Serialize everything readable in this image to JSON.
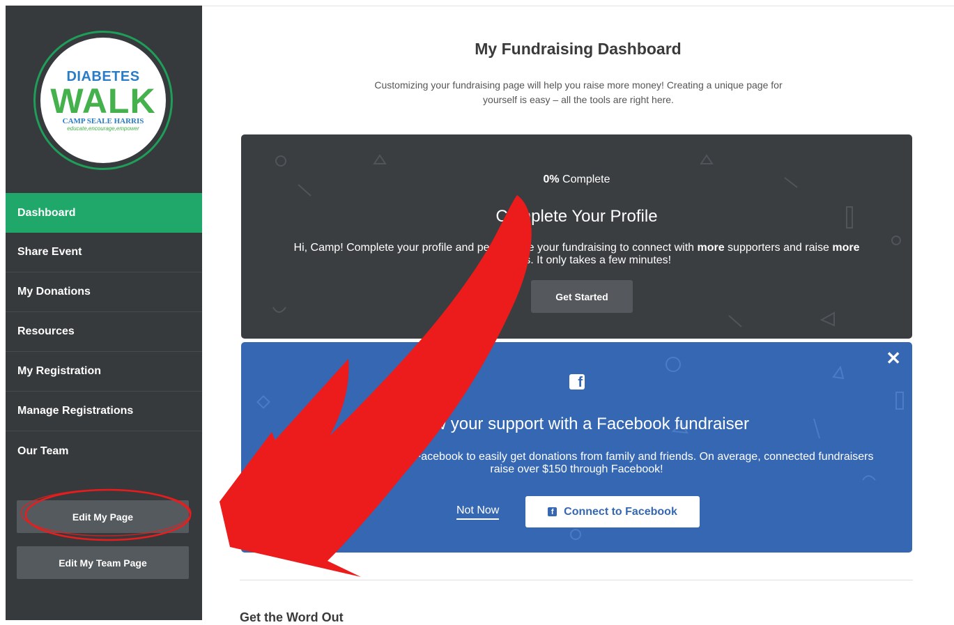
{
  "logo": {
    "top": "DIABETES",
    "walk": "WALK",
    "camp": "CAMP SEALE HARRIS",
    "tagline": "educate,encourage,empower"
  },
  "sidebar": {
    "items": [
      {
        "label": "Dashboard",
        "active": true
      },
      {
        "label": "Share Event"
      },
      {
        "label": "My Donations"
      },
      {
        "label": "Resources"
      },
      {
        "label": "My Registration"
      },
      {
        "label": "Manage Registrations"
      },
      {
        "label": "Our Team"
      }
    ],
    "buttons": {
      "edit_page": "Edit My Page",
      "edit_team_page": "Edit My Team Page"
    }
  },
  "main": {
    "title": "My Fundraising Dashboard",
    "subtitle": "Customizing your fundraising page will help you raise more money! Creating a unique page for yourself is easy – all the tools are right here.",
    "profile_card": {
      "progress_value": "0%",
      "progress_label": "Complete",
      "heading": "Complete Your Profile",
      "text_part1": "Hi, Camp! Complete your profile and personalize your fundraising to connect with ",
      "text_bold1": "more",
      "text_part2": " supporters and raise ",
      "text_bold2": "more",
      "text_part3": " donations. It only takes a few minutes!",
      "button": "Get Started"
    },
    "facebook_card": {
      "close": "✕",
      "heading": "Show your support with a Facebook fundraiser",
      "text": "Connect your fundraiser to Facebook to easily get donations from family and friends. On average, connected fundraisers raise over $150 through Facebook!",
      "not_now": "Not Now",
      "connect": "Connect to Facebook"
    },
    "section_title": "Get the Word Out"
  },
  "colors": {
    "sidebar": "#363a3d",
    "accent_green": "#1fa86a",
    "card_dark": "#3b3e41",
    "facebook_blue": "#3567b3",
    "annotation_red": "#ec1c1c"
  }
}
